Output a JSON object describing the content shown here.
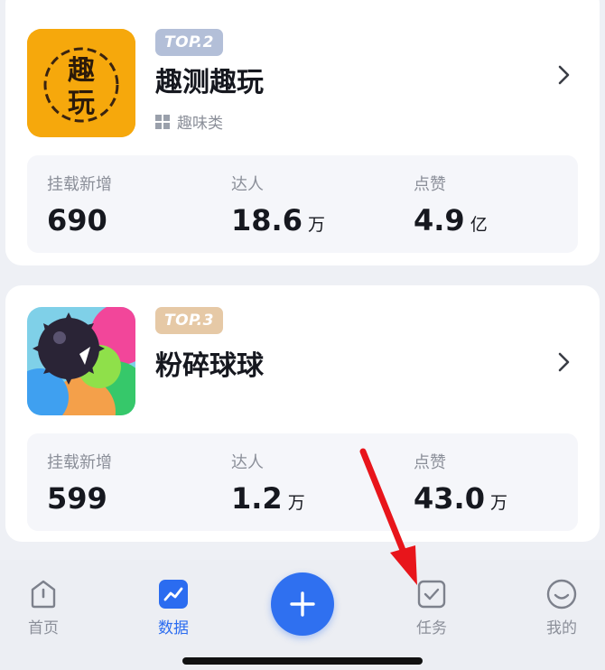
{
  "apps": [
    {
      "rank": "TOP.2",
      "name": "趣测趣玩",
      "category": "趣味类",
      "icon": "qu-ce-qu-wan-app-icon",
      "icon_text": "趣玩",
      "stats": [
        {
          "label": "挂载新增",
          "value": "690",
          "unit": ""
        },
        {
          "label": "达人",
          "value": "18.6",
          "unit": "万"
        },
        {
          "label": "点赞",
          "value": "4.9",
          "unit": "亿"
        }
      ]
    },
    {
      "rank": "TOP.3",
      "name": "粉碎球球",
      "category": "",
      "icon": "fen-sui-qiu-qiu-app-icon",
      "stats": [
        {
          "label": "挂载新增",
          "value": "599",
          "unit": ""
        },
        {
          "label": "达人",
          "value": "1.2",
          "unit": "万"
        },
        {
          "label": "点赞",
          "value": "43.0",
          "unit": "万"
        }
      ]
    }
  ],
  "tabbar": {
    "items": [
      {
        "label": "首页",
        "icon": "home-icon"
      },
      {
        "label": "数据",
        "icon": "chart-icon",
        "active": true
      },
      {
        "label": "",
        "icon": "plus-icon"
      },
      {
        "label": "任务",
        "icon": "task-check-icon"
      },
      {
        "label": "我的",
        "icon": "smile-icon"
      }
    ]
  },
  "colors": {
    "accent": "#2f70f0",
    "rank_silver": "#b3bfd8",
    "rank_bronze": "#e6c9a6",
    "annotation_arrow": "#e8151b",
    "qu_icon_bg": "#f6a80c"
  }
}
